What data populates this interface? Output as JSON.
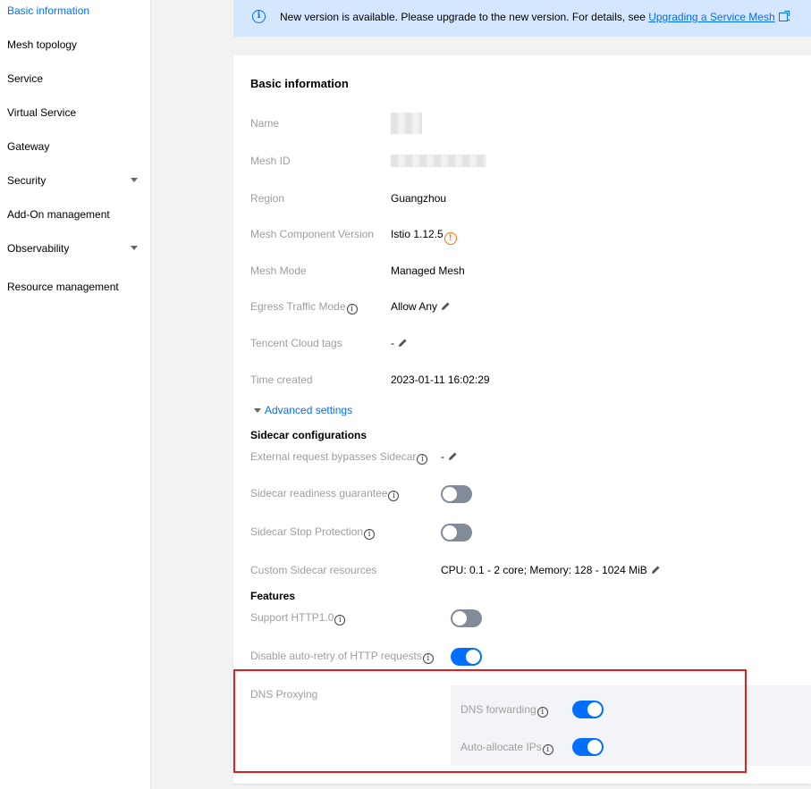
{
  "sidebar": {
    "items": [
      {
        "label": "Basic information",
        "active": true,
        "expandable": false
      },
      {
        "label": "Mesh topology",
        "active": false,
        "expandable": false
      },
      {
        "label": "Service",
        "active": false,
        "expandable": false
      },
      {
        "label": "Virtual Service",
        "active": false,
        "expandable": false
      },
      {
        "label": "Gateway",
        "active": false,
        "expandable": false
      },
      {
        "label": "Security",
        "active": false,
        "expandable": true
      },
      {
        "label": "Add-On management",
        "active": false,
        "expandable": false
      },
      {
        "label": "Observability",
        "active": false,
        "expandable": true
      },
      {
        "label": "Resource management",
        "active": false,
        "expandable": false
      }
    ]
  },
  "notice": {
    "icon": "info-icon",
    "text": "New version is available. Please upgrade to the new version. For details, see ",
    "link": "Upgrading a Service Mesh",
    "suffix": "."
  },
  "card": {
    "title": "Basic information",
    "fields": {
      "name": {
        "label": "Name"
      },
      "mesh_id": {
        "label": "Mesh ID"
      },
      "region": {
        "label": "Region",
        "value": "Guangzhou"
      },
      "version": {
        "label": "Mesh Component Version",
        "value": "Istio 1.12.5"
      },
      "mode": {
        "label": "Mesh Mode",
        "value": "Managed Mesh"
      },
      "egress": {
        "label": "Egress Traffic Mode",
        "value": "Allow Any"
      },
      "tags": {
        "label": "Tencent Cloud tags",
        "value": "-"
      },
      "created": {
        "label": "Time created",
        "value": "2023-01-11 16:02:29"
      }
    },
    "advanced_link": "Advanced settings",
    "sidecar": {
      "title": "Sidecar configurations",
      "bypass": {
        "label": "External request bypasses Sidecar",
        "value": "-"
      },
      "readiness": {
        "label": "Sidecar readiness guarantee",
        "on": false
      },
      "stop": {
        "label": "Sidecar Stop Protection",
        "on": false
      },
      "resources": {
        "label": "Custom Sidecar resources",
        "value": "CPU: 0.1 - 2 core; Memory: 128 - 1024 MiB"
      }
    },
    "features": {
      "title": "Features",
      "http10": {
        "label": "Support HTTP1.0",
        "on": false
      },
      "retry": {
        "label": "Disable auto-retry of HTTP requests",
        "on": true
      },
      "dns": {
        "label": "DNS Proxying",
        "forwarding": {
          "label": "DNS forwarding",
          "on": true
        },
        "auto_ip": {
          "label": "Auto-allocate IPs",
          "on": true
        }
      }
    }
  },
  "colors": {
    "accent": "#006eff",
    "notice_bg": "#d5e7ff",
    "toggle_off": "#818b99",
    "warning": "#ff7200",
    "highlight": "#e02020"
  }
}
